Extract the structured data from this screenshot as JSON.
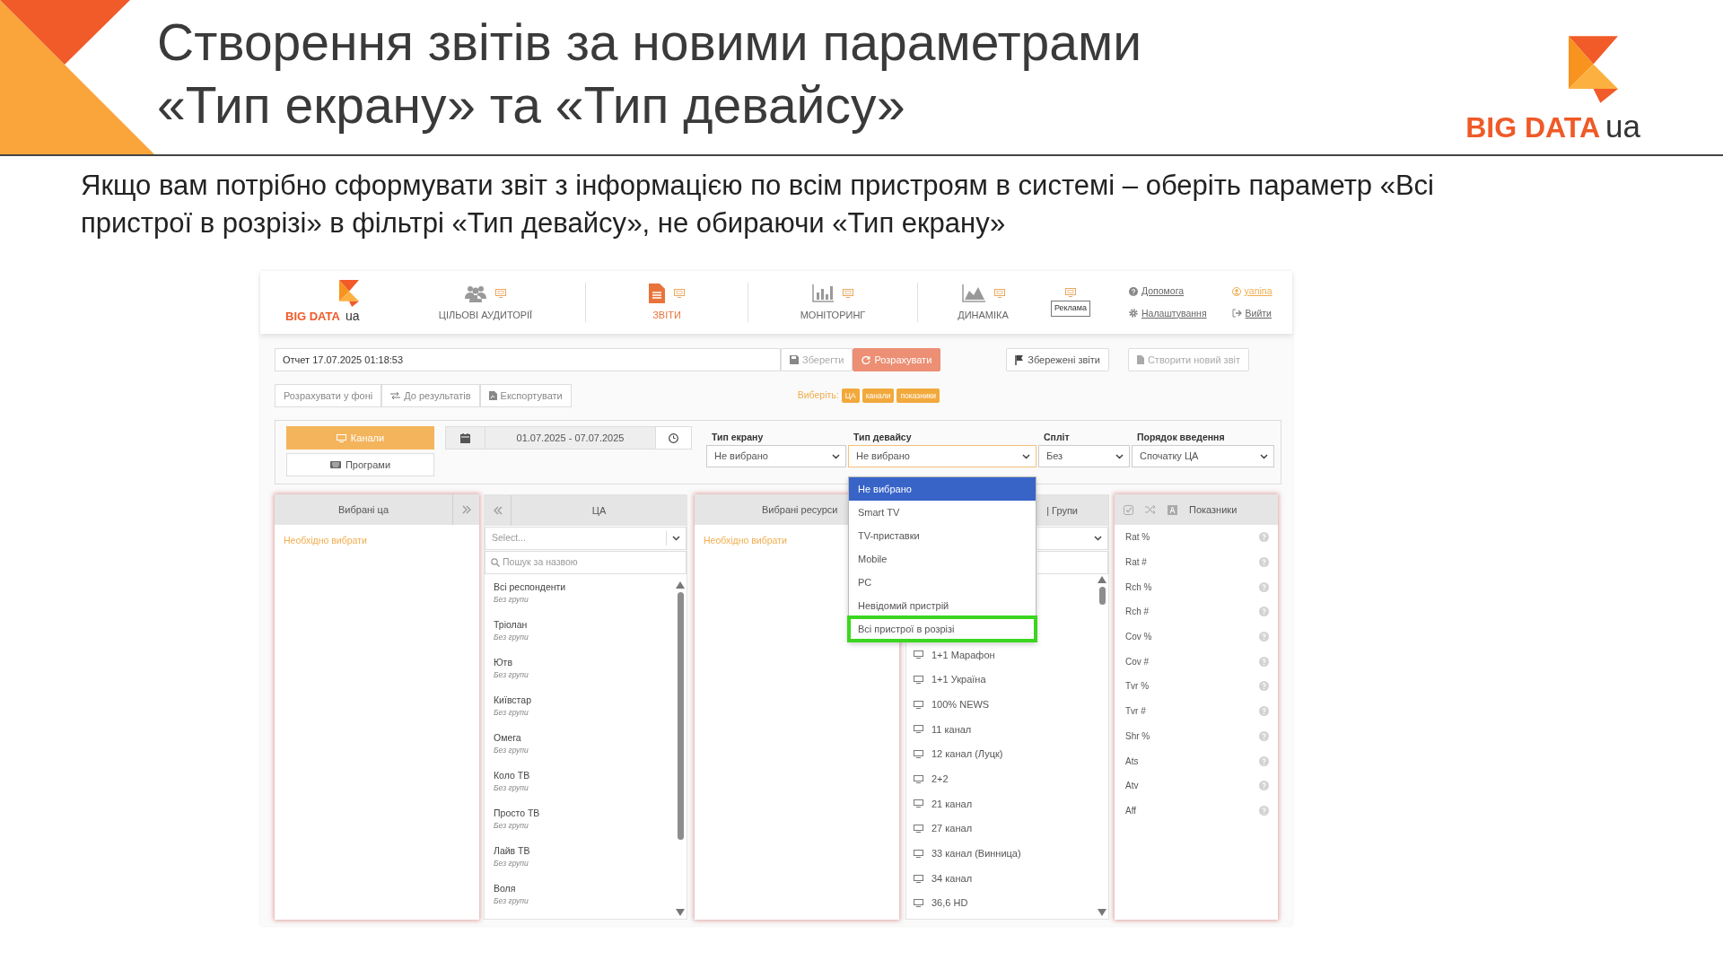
{
  "slide": {
    "title_lines": [
      "Створення звітів за новими параметрами",
      "«Тип екрану» та «Тип девайсу»"
    ],
    "logo": {
      "brand": "BIG DATA",
      "suffix": "ua"
    },
    "paragraph": "Якщо вам потрібно сформувати звіт з інформацією по всім пристроям в системі – оберіть параметр «Всі пристрої в розрізі» в фільтрі «Тип девайсу», не обираючи «Тип екрану»"
  },
  "app": {
    "logo": {
      "brand": "BIG DATA",
      "suffix": "ua"
    },
    "nav": [
      {
        "label": "ЦІЛЬОВІ АУДИТОРІЇ",
        "kind": "audiences",
        "selected": false
      },
      {
        "label": "ЗВІТИ",
        "kind": "reports",
        "selected": true
      },
      {
        "label": "МОНІТОРИНГ",
        "kind": "monitoring",
        "selected": false
      },
      {
        "label": "ДИНАМІКА",
        "kind": "dynamics",
        "selected": false
      }
    ],
    "ad_label": "Реклама",
    "help_links": [
      {
        "label": "Допомога",
        "kind": "help"
      },
      {
        "label": "Налаштування",
        "kind": "settings"
      }
    ],
    "user_links": [
      {
        "label": "yanina",
        "kind": "user"
      },
      {
        "label": "Вийти",
        "kind": "logout"
      }
    ],
    "report_name": "Отчет 17.07.2025 01:18:53",
    "report_actions": [
      {
        "label": "Зберегти",
        "kind": "save",
        "disabled": true
      },
      {
        "label": "Розрахувати",
        "kind": "calculate",
        "disabled": false
      }
    ],
    "report_links": [
      {
        "label": "Збережені звіти",
        "kind": "saved",
        "disabled": false
      },
      {
        "label": "Створити новий звіт",
        "kind": "new",
        "disabled": true
      }
    ],
    "secondary_actions": [
      {
        "label": "Розрахувати у фоні",
        "kind": "background"
      },
      {
        "label": "До результатів",
        "kind": "results"
      },
      {
        "label": "Експортувати",
        "kind": "export"
      }
    ],
    "choose": {
      "label": "Виберіть:",
      "tags": [
        "ЦА",
        "канали",
        "показники"
      ]
    },
    "modes": [
      {
        "label": "Канали",
        "kind": "channels",
        "selected": true
      },
      {
        "label": "Програми",
        "kind": "programs",
        "selected": false
      }
    ],
    "period": "01.07.2025 - 07.07.2025",
    "selects": [
      {
        "label": "Тип екрану",
        "value": "Не вибрано",
        "open": false
      },
      {
        "label": "Тип девайсу",
        "value": "Не вибрано",
        "open": true
      },
      {
        "label": "Спліт",
        "value": "Без",
        "open": false
      },
      {
        "label": "Порядок введення",
        "value": "Спочатку ЦА",
        "open": false
      }
    ],
    "device_options": [
      {
        "label": "Не вибрано",
        "selected": true,
        "highlighted": false
      },
      {
        "label": "Smart TV",
        "selected": false,
        "highlighted": false
      },
      {
        "label": "TV-приставки",
        "selected": false,
        "highlighted": false
      },
      {
        "label": "Mobile",
        "selected": false,
        "highlighted": false
      },
      {
        "label": "PC",
        "selected": false,
        "highlighted": false
      },
      {
        "label": "Невідомий пристрій",
        "selected": false,
        "highlighted": false
      },
      {
        "label": "Всі пристрої в розрізі",
        "selected": false,
        "highlighted": true
      }
    ],
    "selected_audiences": {
      "title": "Вибрані ца",
      "empty_text": "Необхідно вибрати"
    },
    "audiences": {
      "title": "ЦА",
      "select_placeholder": "Select...",
      "search_placeholder": "Пошук за назвою",
      "items": [
        {
          "name": "Всі респонденти",
          "group": "Без групи"
        },
        {
          "name": "Тріолан",
          "group": "Без групи"
        },
        {
          "name": "Ютв",
          "group": "Без групи"
        },
        {
          "name": "Київстар",
          "group": "Без групи"
        },
        {
          "name": "Омега",
          "group": "Без групи"
        },
        {
          "name": "Коло ТВ",
          "group": "Без групи"
        },
        {
          "name": "Просто ТВ",
          "group": "Без групи"
        },
        {
          "name": "Лайв ТВ",
          "group": "Без групи"
        },
        {
          "name": "Воля",
          "group": "Без групи"
        }
      ]
    },
    "selected_resources": {
      "title": "Вибрані ресурси",
      "empty_text": "Необхідно вибрати"
    },
    "channels": {
      "title": "| Групи",
      "items": [
        "1+1 Марафон",
        "1+1 Україна",
        "100% NEWS",
        "11 канал",
        "12 канал (Луцк)",
        "2+2",
        "21 канал",
        "27 канал",
        "33 канал (Винница)",
        "34 канал",
        "36,6 HD"
      ]
    },
    "metrics": {
      "title": "Показники",
      "items": [
        "Rat %",
        "Rat #",
        "Rch %",
        "Rch #",
        "Cov %",
        "Cov #",
        "Tvr %",
        "Tvr #",
        "Shr %",
        "Ats",
        "Atv",
        "Aff"
      ]
    }
  }
}
